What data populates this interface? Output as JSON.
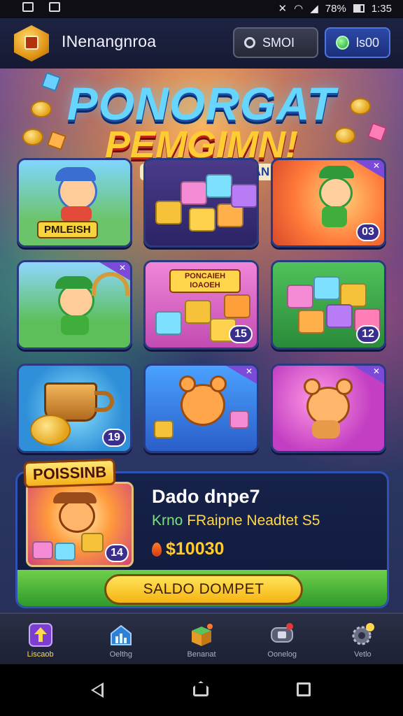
{
  "status_bar": {
    "battery": "78%",
    "time": "1:35"
  },
  "header": {
    "player_name": "INenangnroa",
    "search_value": "SMOI",
    "coins_value": "ls00"
  },
  "banner": {
    "title_line1": "PONORGAT",
    "title_line2": "PEMGIMN!",
    "subtitle": "LEKNOMIUIE SOAN"
  },
  "tiles": [
    {
      "label": "PMLEISH",
      "badge": ""
    },
    {
      "label": "",
      "badge": ""
    },
    {
      "label": "",
      "badge": "03"
    },
    {
      "label": "",
      "badge": ""
    },
    {
      "label": "PONCAIEH IOAOEH",
      "badge": "15"
    },
    {
      "label": "",
      "badge": "12"
    },
    {
      "label": "",
      "badge": "19"
    },
    {
      "label": "",
      "badge": ""
    },
    {
      "label": "",
      "badge": ""
    }
  ],
  "feature": {
    "tag": "POISSINB",
    "thumb_badge": "14",
    "title": "Dado dnpe7",
    "subtitle_prefix": "Krno",
    "subtitle_rest": "FRaipne Neadtet S5",
    "price": "$10030",
    "cta": "SALDO DOMPET"
  },
  "bottom_nav": [
    {
      "label": "Liscaob",
      "icon": "home-up-icon"
    },
    {
      "label": "Oelthg",
      "icon": "stats-icon"
    },
    {
      "label": "Benanat",
      "icon": "box-icon"
    },
    {
      "label": "Oonelog",
      "icon": "chat-icon"
    },
    {
      "label": "Vetlo",
      "icon": "gear-icon"
    }
  ],
  "colors": {
    "accent_gold": "#ffcc33",
    "accent_blue": "#66d6ff",
    "panel_border": "#2f52b4",
    "cta_green": "#2f9a2b"
  }
}
